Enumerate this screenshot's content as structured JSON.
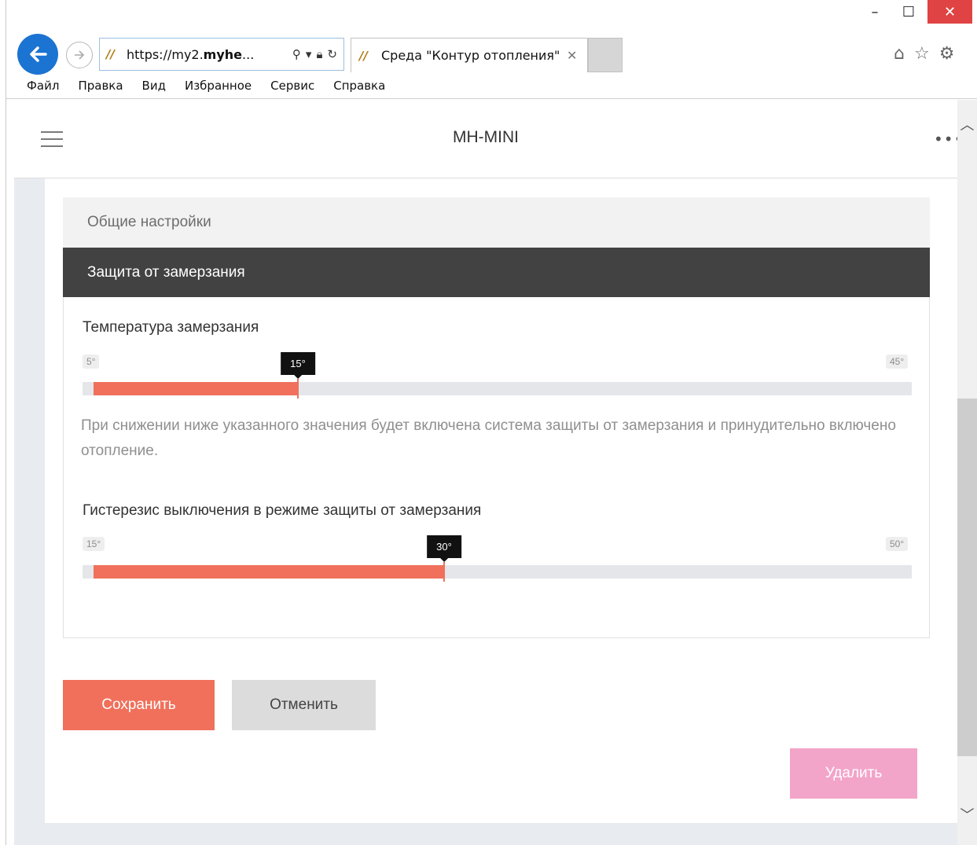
{
  "window": {
    "minimize_label": "–",
    "maximize_label": "☐",
    "close_label": "✕"
  },
  "browser": {
    "url_prefix": "https://my2.",
    "url_bold": "myhe",
    "url_suffix": "...",
    "tab_title": "Среда \"Контур отопления\"",
    "tab_close": "✕",
    "menu": [
      {
        "label": "Файл"
      },
      {
        "label": "Правка"
      },
      {
        "label": "Вид"
      },
      {
        "label": "Избранное"
      },
      {
        "label": "Сервис"
      },
      {
        "label": "Справка"
      }
    ],
    "icons": [
      "back-arrow-icon",
      "forward-arrow-icon",
      "search-icon",
      "lock-icon",
      "refresh-icon",
      "home-icon",
      "star-icon",
      "gear-icon"
    ]
  },
  "app": {
    "title": "MH-MINI",
    "more": "•••"
  },
  "sections": {
    "general": "Общие настройки",
    "freeze": "Защита от замерзания"
  },
  "freeze_temp": {
    "label": "Температура замерзания",
    "min": "5°",
    "max": "45°",
    "value_label": "15°",
    "min_value": 5,
    "max_value": 45,
    "value": 15,
    "hint": "При снижении ниже указанного значения будет включена система защиты от замерзания и принудительно включено отопление."
  },
  "hysteresis": {
    "label": "Гистерезис выключения в режиме защиты от замерзания",
    "min": "15°",
    "max": "50°",
    "value_label": "30°",
    "min_value": 15,
    "max_value": 50,
    "value": 30
  },
  "buttons": {
    "save": "Сохранить",
    "cancel": "Отменить",
    "delete": "Удалить"
  },
  "colors": {
    "accent": "#f0705b",
    "delete": "#f3a4c9",
    "section_dark": "#424242"
  }
}
